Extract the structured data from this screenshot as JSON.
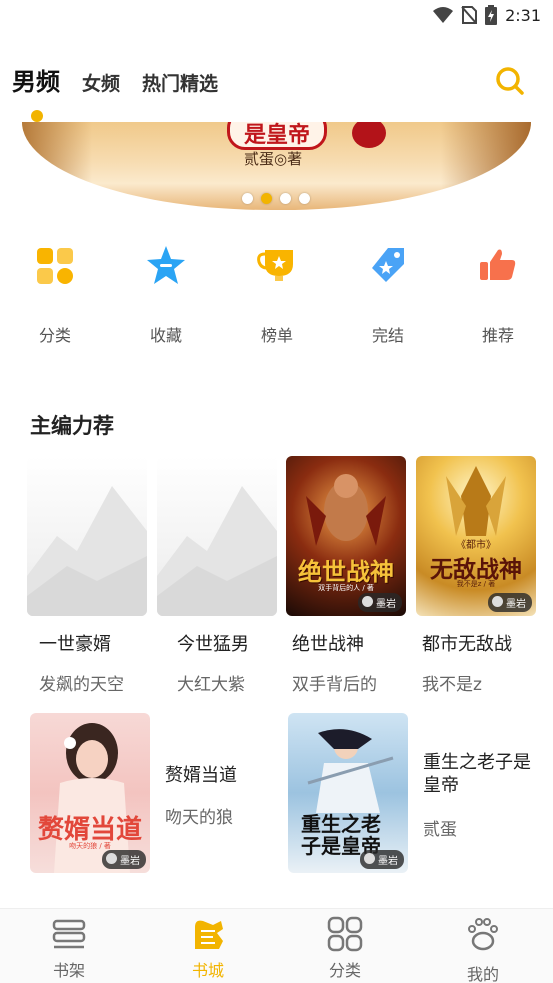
{
  "status_bar": {
    "time": "2:31",
    "icons": [
      "wifi-icon",
      "no-sim-icon",
      "battery-icon"
    ]
  },
  "top_tabs": [
    {
      "label": "男频",
      "active": true
    },
    {
      "label": "女频",
      "active": false
    },
    {
      "label": "热门精选",
      "active": false
    }
  ],
  "banner": {
    "title_text": "是皇帝",
    "author_text": "贰蛋◎著",
    "slide_count": 4,
    "active_slide": 2
  },
  "categories": [
    {
      "label": "分类",
      "icon": "grid-icon"
    },
    {
      "label": "收藏",
      "icon": "star-icon"
    },
    {
      "label": "榜单",
      "icon": "trophy-icon"
    },
    {
      "label": "完结",
      "icon": "tag-icon"
    },
    {
      "label": "推荐",
      "icon": "thumbs-up-icon"
    }
  ],
  "section": {
    "title": "主编力荐"
  },
  "books_row1": [
    {
      "title": "一世豪婿",
      "author": "发飙的天空",
      "cover": "placeholder"
    },
    {
      "title": "今世猛男",
      "author": "大红大紫",
      "cover": "placeholder"
    },
    {
      "title": "绝世战神",
      "author": "双手背后的",
      "cover_title": "绝世战神",
      "cover_author": "双手背后的人 / 著",
      "badge": "墨岩"
    },
    {
      "title": "都市无敌战",
      "author": "我不是z",
      "cover_title": "无敌战神",
      "cover_subtitle": "《都市》",
      "cover_author": "我不是z / 著",
      "badge": "墨岩"
    }
  ],
  "books_row2": [
    {
      "title": "赘婿当道",
      "author": "吻天的狼",
      "cover_title": "赘婿当道",
      "cover_author": "吻天的狼 / 著",
      "badge": "墨岩"
    },
    {
      "title": "重生之老子是皇帝",
      "author": "贰蛋",
      "cover_title": "重生之老子是皇帝",
      "badge": "墨岩"
    }
  ],
  "bottom_nav": [
    {
      "label": "书架",
      "icon": "bookshelf-icon",
      "active": false
    },
    {
      "label": "书城",
      "icon": "bookstore-icon",
      "active": true
    },
    {
      "label": "分类",
      "icon": "category-icon",
      "active": false
    },
    {
      "label": "我的",
      "icon": "paw-icon",
      "active": false
    }
  ],
  "colors": {
    "accent": "#f2b400"
  }
}
